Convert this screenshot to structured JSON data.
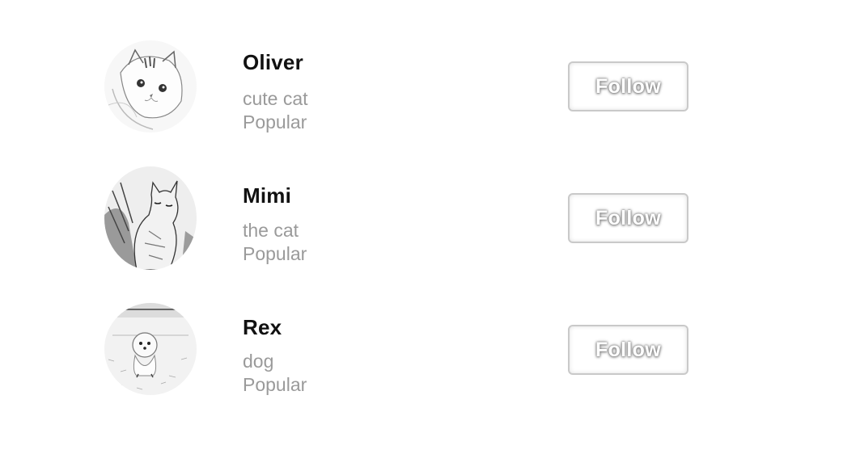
{
  "users": [
    {
      "name": "Oliver",
      "subtitle": "cute cat",
      "badge": "Popular",
      "avatar_icon": "kitten-face-photo",
      "follow_label": "Follow"
    },
    {
      "name": "Mimi",
      "subtitle": "the cat",
      "badge": "Popular",
      "avatar_icon": "sitting-cat-photo",
      "follow_label": "Follow"
    },
    {
      "name": "Rex",
      "subtitle": "dog",
      "badge": "Popular",
      "avatar_icon": "fluffy-dog-photo",
      "follow_label": "Follow"
    }
  ],
  "colors": {
    "name": "#111111",
    "secondary_text": "#9a9a9a",
    "button_border": "#c9c9c9"
  }
}
